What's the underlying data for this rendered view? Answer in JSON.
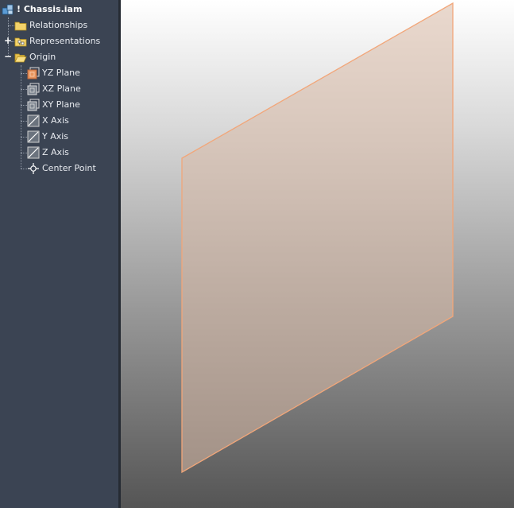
{
  "browser": {
    "root": {
      "label": "! Chassis.iam",
      "icon": "assembly-icon"
    },
    "items": [
      {
        "label": "Relationships",
        "icon": "folder-icon",
        "expander": ""
      },
      {
        "label": "Representations",
        "icon": "representations-icon",
        "expander": "+"
      },
      {
        "label": "Origin",
        "icon": "folder-open-icon",
        "expander": "−"
      }
    ],
    "origin_children": [
      {
        "label": "YZ Plane",
        "icon": "work-plane-highlighted-icon"
      },
      {
        "label": "XZ Plane",
        "icon": "work-plane-icon"
      },
      {
        "label": "XY Plane",
        "icon": "work-plane-icon"
      },
      {
        "label": "X Axis",
        "icon": "work-axis-icon"
      },
      {
        "label": "Y Axis",
        "icon": "work-axis-icon"
      },
      {
        "label": "Z Axis",
        "icon": "work-axis-icon"
      },
      {
        "label": "Center Point",
        "icon": "center-point-icon"
      }
    ]
  },
  "viewport": {
    "highlight_color": "#f2a679",
    "plane_fill": "#d9b9a6"
  }
}
